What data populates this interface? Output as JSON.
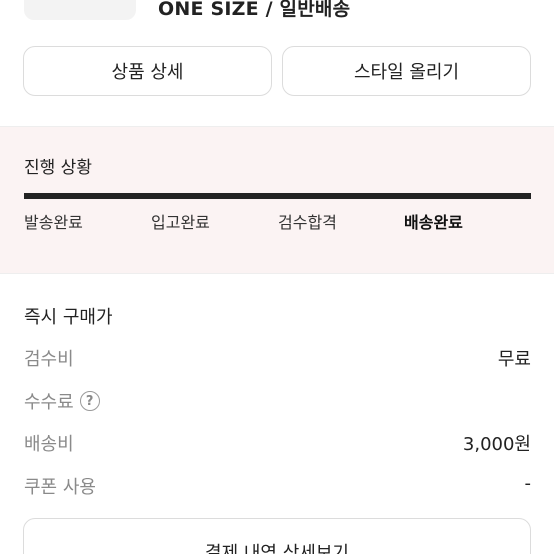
{
  "product": {
    "option_text": "ONE SIZE / 일반배송"
  },
  "actions": {
    "product_detail_label": "상품 상세",
    "style_upload_label": "스타일 올리기"
  },
  "progress": {
    "title": "진행 상황",
    "steps": [
      {
        "label": "발송완료"
      },
      {
        "label": "입고완료"
      },
      {
        "label": "검수합격"
      },
      {
        "label": "배송완료"
      }
    ],
    "current_step": "배송완료",
    "bar_color": "#222222",
    "background_color": "#fbf3f3"
  },
  "price": {
    "title": "즉시 구매가",
    "rows": [
      {
        "label": "검수비",
        "value": "무료"
      },
      {
        "label": "수수료",
        "value": ""
      },
      {
        "label": "배송비",
        "value": "3,000원"
      },
      {
        "label": "쿠폰 사용",
        "value": "-"
      }
    ],
    "help_icon_glyph": "?"
  },
  "footer": {
    "detail_button_label": "결제 내역 상세보기"
  }
}
